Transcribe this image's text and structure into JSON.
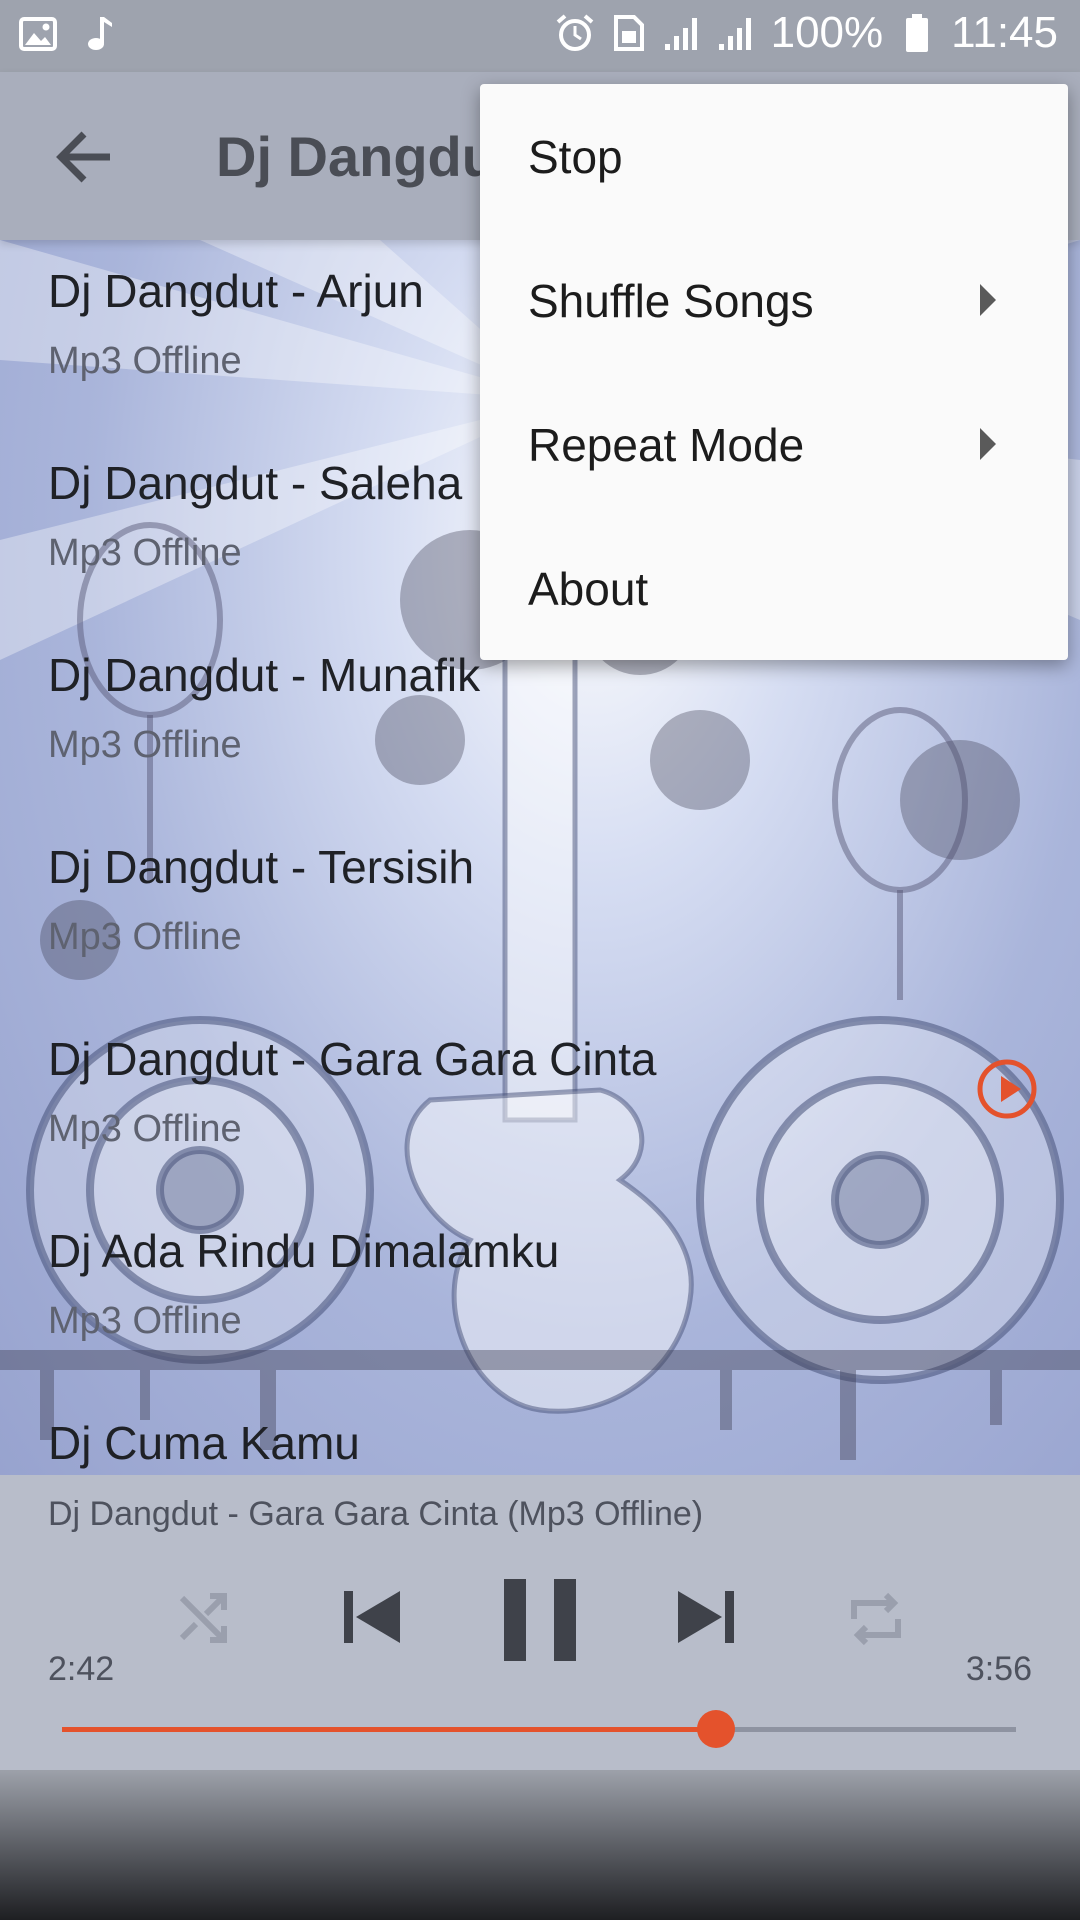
{
  "status_bar": {
    "battery": "100%",
    "time": "11:45",
    "icons_left": [
      "image-icon",
      "music-note-icon"
    ],
    "icons_right": [
      "alarm-icon",
      "sim-icon",
      "signal-icon",
      "signal-icon"
    ]
  },
  "app_bar": {
    "title": "Dj Dangdu"
  },
  "songs": [
    {
      "title": "Dj Dangdut - Arjun",
      "subtitle": "Mp3 Offline"
    },
    {
      "title": "Dj Dangdut - Saleha",
      "subtitle": "Mp3 Offline"
    },
    {
      "title": "Dj Dangdut - Munafik",
      "subtitle": "Mp3 Offline"
    },
    {
      "title": "Dj Dangdut - Tersisih",
      "subtitle": "Mp3 Offline"
    },
    {
      "title": "Dj Dangdut - Gara Gara Cinta",
      "subtitle": "Mp3 Offline",
      "playing": true
    },
    {
      "title": "Dj Ada Rindu Dimalamku",
      "subtitle": "Mp3 Offline"
    },
    {
      "title": "Dj Cuma Kamu",
      "subtitle": ""
    }
  ],
  "player": {
    "now_playing": "Dj Dangdut - Gara Gara Cinta (Mp3 Offline)",
    "elapsed": "2:42",
    "total": "3:56",
    "progress_fraction": 0.686,
    "accent_color": "#e4522c"
  },
  "menu": {
    "items": [
      {
        "label": "Stop",
        "submenu": false
      },
      {
        "label": "Shuffle Songs",
        "submenu": true
      },
      {
        "label": "Repeat Mode",
        "submenu": true
      },
      {
        "label": "About",
        "submenu": false
      }
    ]
  }
}
